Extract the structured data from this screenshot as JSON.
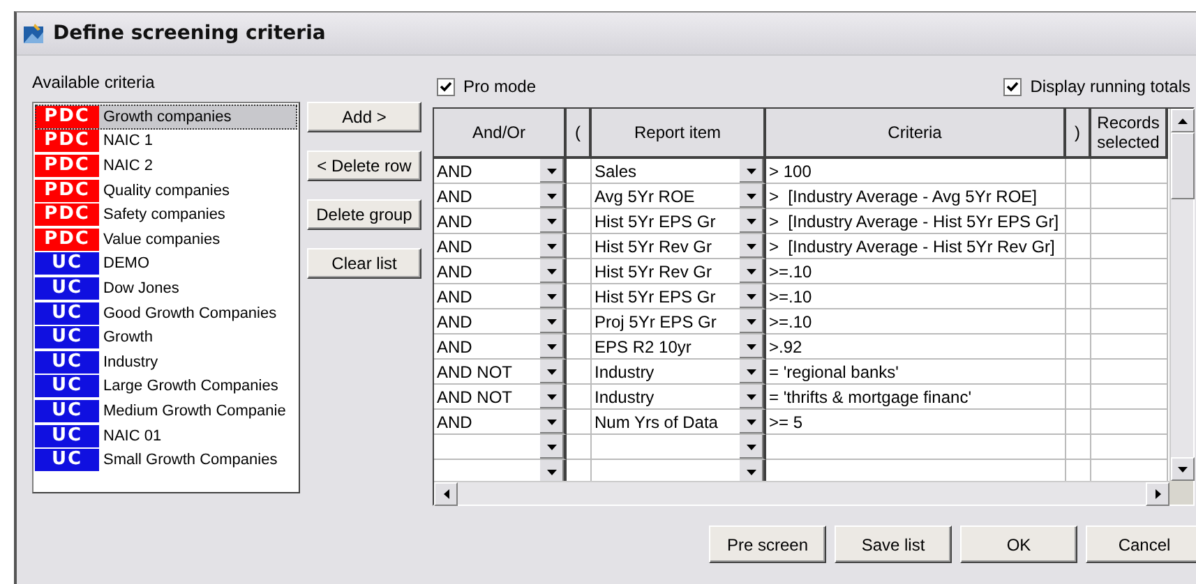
{
  "window": {
    "title": "Define screening criteria"
  },
  "available_label": "Available criteria",
  "criteria_list": [
    {
      "kind": "pdc",
      "badge": "PDC",
      "label": "Growth companies",
      "selected": true
    },
    {
      "kind": "pdc",
      "badge": "PDC",
      "label": "NAIC 1",
      "selected": false
    },
    {
      "kind": "pdc",
      "badge": "PDC",
      "label": "NAIC 2",
      "selected": false
    },
    {
      "kind": "pdc",
      "badge": "PDC",
      "label": "Quality companies",
      "selected": false
    },
    {
      "kind": "pdc",
      "badge": "PDC",
      "label": "Safety companies",
      "selected": false
    },
    {
      "kind": "pdc",
      "badge": "PDC",
      "label": "Value companies",
      "selected": false
    },
    {
      "kind": "uc",
      "badge": "UC",
      "label": "DEMO",
      "selected": false
    },
    {
      "kind": "uc",
      "badge": "UC",
      "label": "Dow Jones",
      "selected": false
    },
    {
      "kind": "uc",
      "badge": "UC",
      "label": "Good Growth Companies",
      "selected": false
    },
    {
      "kind": "uc",
      "badge": "UC",
      "label": "Growth",
      "selected": false
    },
    {
      "kind": "uc",
      "badge": "UC",
      "label": "Industry",
      "selected": false
    },
    {
      "kind": "uc",
      "badge": "UC",
      "label": "Large Growth Companies",
      "selected": false
    },
    {
      "kind": "uc",
      "badge": "UC",
      "label": "Medium Growth Companie",
      "selected": false
    },
    {
      "kind": "uc",
      "badge": "UC",
      "label": "NAIC 01",
      "selected": false
    },
    {
      "kind": "uc",
      "badge": "UC",
      "label": "Small Growth Companies",
      "selected": false
    }
  ],
  "side_buttons": [
    "Add >",
    "< Delete row",
    "Delete group",
    "Clear list"
  ],
  "pro_mode": {
    "label": "Pro mode",
    "checked": true
  },
  "running_totals": {
    "label": "Display running totals",
    "checked": true
  },
  "columns": [
    "And/Or",
    "(",
    "Report item",
    "Criteria",
    ")",
    "Records selected"
  ],
  "rows": [
    {
      "kind": "entry",
      "and_or": "AND",
      "report_item": "Sales",
      "criteria": "> 100"
    },
    {
      "kind": "entry",
      "and_or": "AND",
      "report_item": "Avg 5Yr ROE",
      "criteria": ">  [Industry Average - Avg 5Yr ROE]"
    },
    {
      "kind": "entry",
      "and_or": "AND",
      "report_item": "Hist 5Yr EPS Gr",
      "criteria": ">  [Industry Average - Hist 5Yr EPS Gr]"
    },
    {
      "kind": "entry",
      "and_or": "AND",
      "report_item": "Hist 5Yr Rev Gr",
      "criteria": ">  [Industry Average - Hist 5Yr Rev Gr]"
    },
    {
      "kind": "entry",
      "and_or": "AND",
      "report_item": "Hist 5Yr Rev Gr",
      "criteria": ">=.10"
    },
    {
      "kind": "entry",
      "and_or": "AND",
      "report_item": "Hist 5Yr EPS Gr",
      "criteria": ">=.10"
    },
    {
      "kind": "entry",
      "and_or": "AND",
      "report_item": "Proj 5Yr EPS Gr",
      "criteria": ">=.10"
    },
    {
      "kind": "entry",
      "and_or": "AND",
      "report_item": "EPS R2 10yr",
      "criteria": ">.92"
    },
    {
      "kind": "entry",
      "and_or": "AND NOT",
      "report_item": "Industry",
      "criteria": "= 'regional banks'"
    },
    {
      "kind": "entry",
      "and_or": "AND NOT",
      "report_item": "Industry",
      "criteria": "= 'thrifts & mortgage financ'"
    },
    {
      "kind": "entry",
      "and_or": "AND",
      "report_item": "Num Yrs of Data",
      "criteria": ">= 5"
    },
    {
      "kind": "blank"
    },
    {
      "kind": "blank"
    }
  ],
  "footer_buttons": [
    "Pre screen",
    "Save list",
    "OK",
    "Cancel"
  ]
}
